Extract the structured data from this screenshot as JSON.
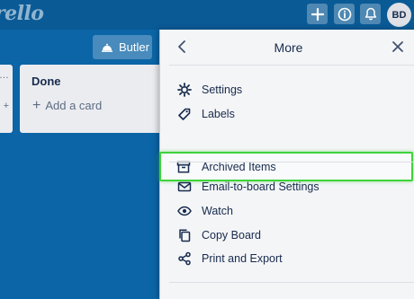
{
  "header": {
    "logo_text": "rello",
    "avatar_initials": "BD",
    "icons": [
      "plus-icon",
      "info-icon",
      "bell-icon"
    ]
  },
  "board": {
    "butler_label": "Butler",
    "list": {
      "title": "Done",
      "add_card_label": "Add a card"
    }
  },
  "panel": {
    "title": "More",
    "items_group1": [
      {
        "label": "Settings",
        "icon": "gear-icon"
      },
      {
        "label": "Labels",
        "icon": "tag-icon"
      },
      {
        "label": "Archived Items",
        "icon": "archive-box-icon",
        "highlighted": true
      }
    ],
    "items_group2": [
      {
        "label": "Email-to-board Settings",
        "icon": "envelope-icon"
      },
      {
        "label": "Watch",
        "icon": "eye-icon"
      },
      {
        "label": "Copy Board",
        "icon": "copy-icon"
      },
      {
        "label": "Print and Export",
        "icon": "share-icon"
      }
    ]
  },
  "colors": {
    "board_background": "#0b65a6",
    "panel_background": "#f4f5f7",
    "highlight_border": "#3fd23b"
  }
}
